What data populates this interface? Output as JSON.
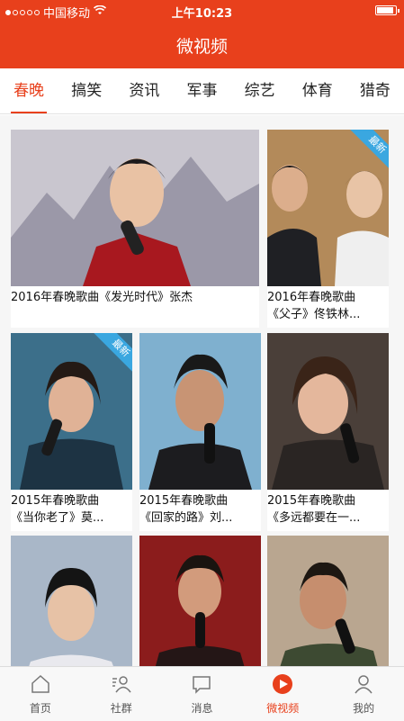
{
  "status": {
    "carrier": "中国移动",
    "time": "上午10:23",
    "battery_level": 0.9
  },
  "title": "微视频",
  "tabs": [
    "春晚",
    "搞笑",
    "资讯",
    "军事",
    "综艺",
    "体育",
    "猎奇"
  ],
  "active_tab": 0,
  "cards": [
    {
      "caption_line1": "2016年春晚歌曲《发光时代》张杰",
      "caption_line2": "",
      "badge": ""
    },
    {
      "caption_line1": "2016年春晚歌曲",
      "caption_line2": "《父子》佟铁林...",
      "badge": "最新"
    },
    {
      "caption_line1": "2015年春晚歌曲",
      "caption_line2": "《当你老了》莫...",
      "badge": "最新"
    },
    {
      "caption_line1": "2015年春晚歌曲",
      "caption_line2": "《回家的路》刘...",
      "badge": ""
    },
    {
      "caption_line1": "2015年春晚歌曲",
      "caption_line2": "《多远都要在一...",
      "badge": ""
    },
    {
      "caption_line1": "",
      "caption_line2": "",
      "badge": ""
    },
    {
      "caption_line1": "",
      "caption_line2": "",
      "badge": ""
    },
    {
      "caption_line1": "",
      "caption_line2": "",
      "badge": ""
    }
  ],
  "nav": [
    {
      "label": "首页",
      "icon": "home-icon"
    },
    {
      "label": "社群",
      "icon": "community-icon"
    },
    {
      "label": "消息",
      "icon": "message-icon"
    },
    {
      "label": "微视频",
      "icon": "play-icon"
    },
    {
      "label": "我的",
      "icon": "profile-icon"
    }
  ],
  "active_nav": 3,
  "colors": {
    "brand": "#e8401c",
    "badge": "#3aa7e0"
  }
}
